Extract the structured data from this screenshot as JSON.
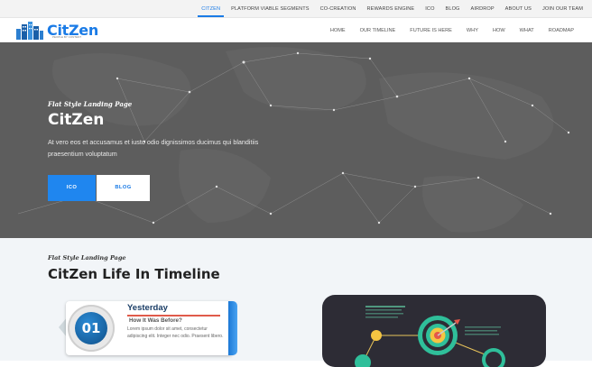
{
  "top_nav": {
    "items": [
      "CITZEN",
      "PLATFORM VIABLE SEGMENTS",
      "CO-CREATION",
      "REWARDS ENGINE",
      "ICO",
      "BLOG",
      "AIRDROP",
      "ABOUT US",
      "JOIN OUR TEAM"
    ],
    "active_index": 0
  },
  "brand": {
    "name": "CitZen",
    "tagline": "PEOPLE BY CONTENT"
  },
  "sub_nav": {
    "items": [
      "HOME",
      "OUR TIMELINE",
      "FUTURE IS HERE",
      "WHY",
      "HOW",
      "WHAT",
      "ROADMAP"
    ]
  },
  "hero": {
    "kicker": "Flat Style Landing Page",
    "title": "CitZen",
    "description": "At vero eos et accusamus et iusto odio dignissimos ducimus qui blanditiis praesentium voluptatum",
    "buttons": {
      "ico": "ICO",
      "blog": "BLOG"
    }
  },
  "timeline_section": {
    "kicker": "Flat Style Landing Page",
    "title": "CitZen Life In Timeline",
    "card": {
      "number": "01",
      "heading": "Yesterday",
      "subheading": "How It Was Before?",
      "text": "Lorem ipsum dolor sit amet, consectetur adipiscing elit. Integer nec odio. Praesent libero."
    }
  },
  "colors": {
    "accent": "#1a7be6",
    "hero_bg": "#5d5d5d",
    "section_bg": "#f2f5f8"
  }
}
